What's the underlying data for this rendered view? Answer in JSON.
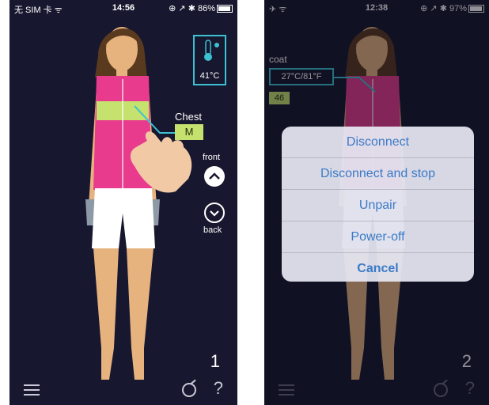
{
  "screen1": {
    "status": {
      "left": "无 SIM 卡 ᯤ",
      "time": "14:56",
      "right": "⊕ ↗ ✱ 86%"
    },
    "temperature": {
      "value": "41°C",
      "icon": "thermometer-sun-icon"
    },
    "chest": {
      "label": "Chest",
      "size": "M"
    },
    "view": {
      "front": "front",
      "back": "back"
    },
    "step": "1",
    "bottom": {
      "menu_icon": "menu-icon",
      "calibrate_icon": "calibrate-icon",
      "help": "?"
    },
    "colors": {
      "vest": "#e83b8e",
      "accent": "#3cc1d1",
      "size_badge": "#c5e26f"
    }
  },
  "screen2": {
    "status": {
      "left": "✈ ᯤ",
      "time": "12:38",
      "right": "⊕ ↗ ✱ 97%"
    },
    "coat": {
      "label": "coat",
      "temp": "27°C/81°F",
      "value": "46"
    },
    "actions": [
      "Disconnect",
      "Disconnect and stop",
      "Unpair",
      "Power-off",
      "Cancel"
    ],
    "step": "2",
    "bottom": {
      "menu_icon": "menu-icon",
      "calibrate_icon": "calibrate-icon",
      "help": "?"
    }
  }
}
